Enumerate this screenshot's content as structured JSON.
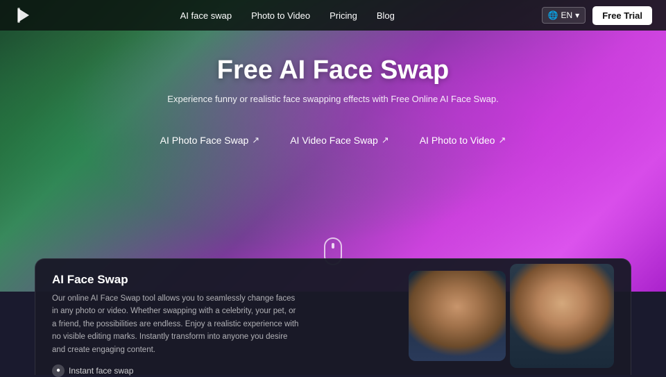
{
  "nav": {
    "links": [
      {
        "label": "AI face swap",
        "id": "ai-face-swap"
      },
      {
        "label": "Photo to Video",
        "id": "photo-to-video"
      },
      {
        "label": "Pricing",
        "id": "pricing"
      },
      {
        "label": "Blog",
        "id": "blog"
      }
    ],
    "lang": "EN",
    "freeTrial": "Free Trial"
  },
  "hero": {
    "title": "Free AI Face Swap",
    "subtitle": "Experience funny or realistic face swapping effects with Free Online AI Face Swap.",
    "tabs": [
      {
        "label": "AI Photo Face Swap",
        "arrow": "↗"
      },
      {
        "label": "AI Video Face Swap",
        "arrow": "↗"
      },
      {
        "label": "AI Photo to Video",
        "arrow": "↗"
      }
    ]
  },
  "bottomCard": {
    "title": "AI Face Swap",
    "description": "Our online AI Face Swap tool allows you to seamlessly change faces in any photo or video. Whether swapping with a celebrity, your pet, or a friend, the possibilities are endless. Enjoy a realistic experience with no visible editing marks. Instantly transform into anyone you desire and create engaging content.",
    "instantSwapLabel": "Instant face swap"
  }
}
